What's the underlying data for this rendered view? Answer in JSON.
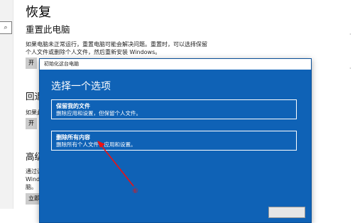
{
  "settings": {
    "page_title": "恢复",
    "reset": {
      "title": "重置此电脑",
      "desc_line1": "如果电脑未正常运行，重置电脑可能会解决问题。重置时，可以选择保留",
      "desc_line2": "个人文件或删除个人文件，然后重新安装 Windows。",
      "button_fragment": "开"
    },
    "rollback": {
      "title_fragment": "回退",
      "desc_fragment": "如果此",
      "button_fragment": "开"
    },
    "advanced": {
      "title_fragment": "高级",
      "desc_fragment1": "通过设",
      "desc_fragment2": "Windo",
      "desc_fragment3": "脑。",
      "button_fragment": "立即"
    },
    "search_glyph": "⌕"
  },
  "dialog": {
    "title": "初始化这台电脑",
    "heading": "选择一个选项",
    "options": [
      {
        "title": "保留我的文件",
        "desc": "删除应用和设置，但保留个人文件。"
      },
      {
        "title": "删除所有内容",
        "desc": "删除所有个人文件、应用和设置。"
      }
    ]
  },
  "annotation": {
    "step_label": "⑥",
    "color": "#e11"
  },
  "colors": {
    "dialog_bg": "#0f62b6",
    "page_bg": "#ffffff"
  }
}
